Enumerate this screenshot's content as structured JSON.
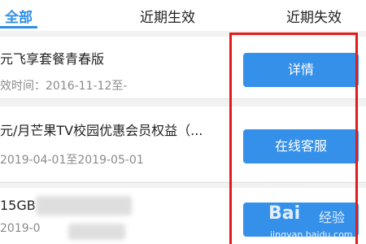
{
  "tabs": [
    {
      "label": "全部"
    },
    {
      "label": "近期生效"
    },
    {
      "label": "近期失效"
    }
  ],
  "items": [
    {
      "name": "元飞享套餐青春版",
      "date": "效时间：2016-11-12至-",
      "action": "详情"
    },
    {
      "name": "元/月芒果TV校园优惠会员权益（...",
      "date": "2019-04-01至2019-05-01",
      "action": "在线客服"
    },
    {
      "name": "15GB",
      "date": "2019-0",
      "action": ""
    }
  ],
  "watermark": {
    "main": "Bai",
    "sub": "经验",
    "url": "jingyan.baidu.com"
  },
  "colors": {
    "accent": "#2f8fe8",
    "button": "#3590ea",
    "highlight": "#e21b1b"
  }
}
